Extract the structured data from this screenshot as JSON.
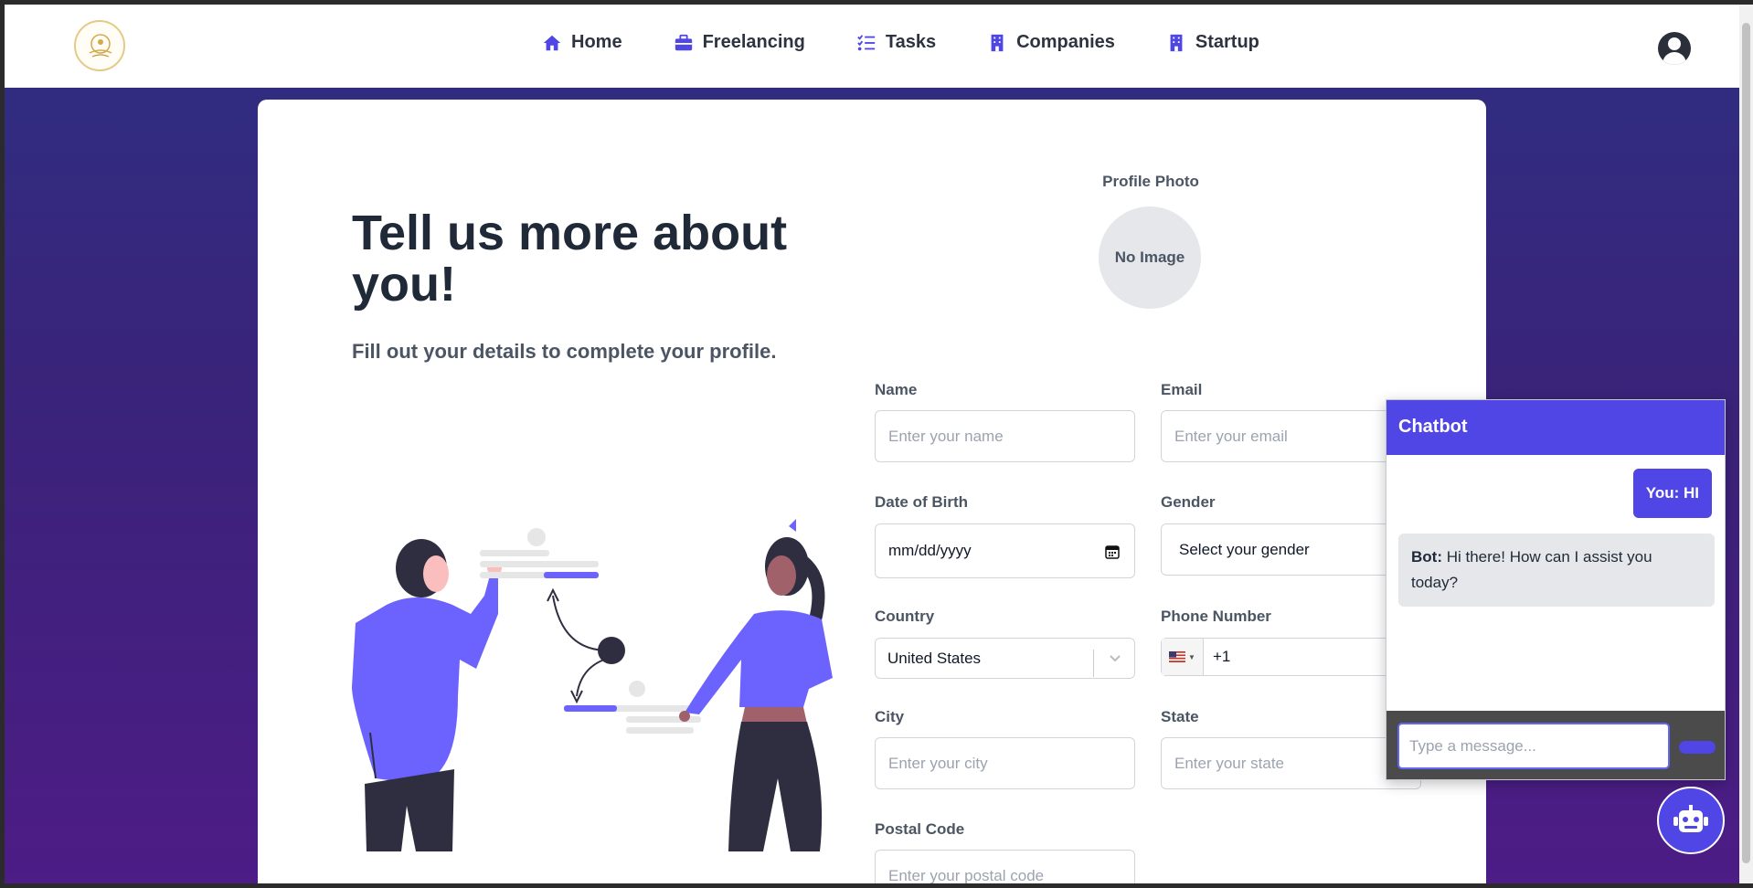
{
  "nav": {
    "items": [
      {
        "label": "Home",
        "icon": "home-icon"
      },
      {
        "label": "Freelancing",
        "icon": "briefcase-icon"
      },
      {
        "label": "Tasks",
        "icon": "list-check-icon"
      },
      {
        "label": "Companies",
        "icon": "building-icon"
      },
      {
        "label": "Startup",
        "icon": "building-icon"
      }
    ],
    "accent": "#4f46e5"
  },
  "hero": {
    "title": "Tell us more about you!",
    "subtitle": "Fill out your details to complete your profile."
  },
  "profile_photo": {
    "label": "Profile Photo",
    "placeholder": "No Image"
  },
  "form": {
    "name": {
      "label": "Name",
      "placeholder": "Enter your name"
    },
    "email": {
      "label": "Email",
      "placeholder": "Enter your email"
    },
    "dob": {
      "label": "Date of Birth",
      "value": "mm/dd/yyyy"
    },
    "gender": {
      "label": "Gender",
      "value": "Select your gender"
    },
    "country": {
      "label": "Country",
      "value": "United States"
    },
    "phone": {
      "label": "Phone Number",
      "value": "+1",
      "flag": "us-flag-icon"
    },
    "city": {
      "label": "City",
      "placeholder": "Enter your city"
    },
    "state": {
      "label": "State",
      "placeholder": "Enter your state"
    },
    "postal": {
      "label": "Postal Code",
      "placeholder": "Enter your postal code"
    }
  },
  "chatbot": {
    "title": "Chatbot",
    "user_message": "You: HI",
    "bot_prefix": "Bot:",
    "bot_message": "Hi there! How can I assist you today?",
    "input_placeholder": "Type a message...",
    "fab_icon": "robot-icon"
  }
}
